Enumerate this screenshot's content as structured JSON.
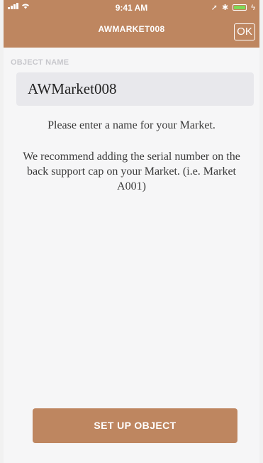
{
  "colors": {
    "brand": "#be8660",
    "background": "#f6f6f7",
    "field": "#e8e8ec",
    "battery": "#7ed957"
  },
  "status_bar": {
    "time": "9:41 AM",
    "icons": [
      "signal-icon",
      "wifi-icon",
      "location-icon",
      "bluetooth-icon",
      "battery-icon",
      "charging-icon"
    ]
  },
  "nav": {
    "title": "AWMARKET008",
    "ok_label": "OK"
  },
  "form": {
    "section_label": "OBJECT NAME",
    "name_value": "AWMarket008",
    "hint_primary": "Please enter a name for your Market.",
    "hint_secondary": "We recommend adding the serial number on the back support cap on your Market. (i.e. Market A001)"
  },
  "actions": {
    "setup_label": "SET UP OBJECT"
  }
}
